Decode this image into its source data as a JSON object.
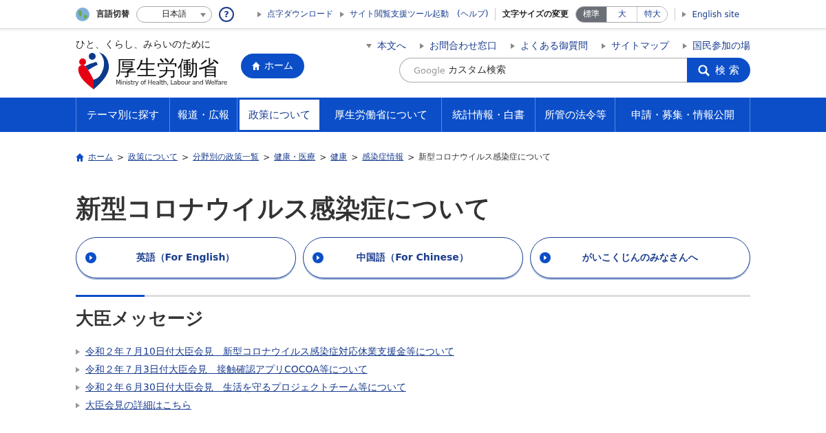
{
  "utility_bar": {
    "language_label": "言語切替",
    "language_select": {
      "value": "日本語"
    },
    "help": "?",
    "links": [
      {
        "label": "点字ダウンロード"
      },
      {
        "label": "サイト閲覧支援ツール起動　(ヘルプ)"
      }
    ],
    "font_size_label": "文字サイズの変更",
    "font_sizes": [
      {
        "label": "標準",
        "selected": true
      },
      {
        "label": "大",
        "selected": false
      },
      {
        "label": "特大",
        "selected": false
      }
    ],
    "english_link": "English site"
  },
  "header": {
    "tagline": "ひと、くらし、みらいのために",
    "logo_text": "厚生労働省",
    "logo_subtext": "Ministry of Health, Labour and Welfare",
    "home_button": "ホーム",
    "links": [
      {
        "label": "本文へ",
        "kind": "down"
      },
      {
        "label": "お問合わせ窓口",
        "kind": "right"
      },
      {
        "label": "よくある御質問",
        "kind": "right"
      },
      {
        "label": "サイトマップ",
        "kind": "right"
      },
      {
        "label": "国民参加の場",
        "kind": "right"
      }
    ],
    "search": {
      "brand": "Google",
      "placeholder": "カスタム検索",
      "button": "検 索"
    }
  },
  "nav": [
    {
      "label": "テーマ別に探す",
      "selected": false
    },
    {
      "label": "報道・広報",
      "selected": false
    },
    {
      "label": "政策について",
      "selected": true
    },
    {
      "label": "厚生労働省について",
      "selected": false
    },
    {
      "label": "統計情報・白書",
      "selected": false
    },
    {
      "label": "所管の法令等",
      "selected": false
    },
    {
      "label": "申請・募集・情報公開",
      "selected": false
    }
  ],
  "breadcrumb": [
    {
      "label": "ホーム",
      "kind": "link"
    },
    {
      "separator": ">",
      "label": "政策について",
      "kind": "link"
    },
    {
      "separator": ">",
      "label": "分野別の政策一覧",
      "kind": "link"
    },
    {
      "separator": ">",
      "label": "健康・医療",
      "kind": "link"
    },
    {
      "separator": ">",
      "label": "健康",
      "kind": "link"
    },
    {
      "separator": ">",
      "label": "感染症情報",
      "kind": "link"
    },
    {
      "separator": ">",
      "label": "新型コロナウイルス感染症について",
      "kind": "current"
    }
  ],
  "page_title": "新型コロナウイルス感染症について",
  "language_buttons": [
    "英語（For English）",
    "中国語（For Chinese）",
    "がいこくじんのみなさんへ"
  ],
  "section": {
    "title": "大臣メッセージ",
    "links": [
      "令和２年７月10日付大臣会見　新型コロナウイルス感染症対応休業支援金等について",
      "令和２年７月3日付大臣会見　接触確認アプリCOCOA等について",
      "令和２年６月30日付大臣会見　生活を守るプロジェクトチーム等について",
      "大臣会見の詳細はこちら"
    ]
  }
}
